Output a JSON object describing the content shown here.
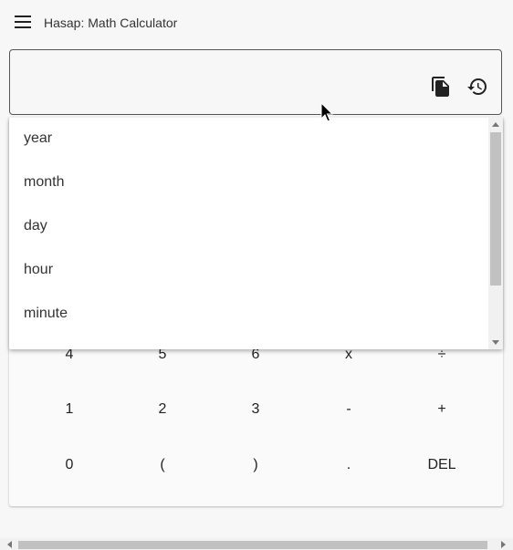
{
  "app": {
    "title": "Hasap: Math Calculator"
  },
  "expression": {
    "value": "",
    "placeholder": ""
  },
  "dropdown": {
    "items": [
      "year",
      "month",
      "day",
      "hour",
      "minute"
    ]
  },
  "keypad": {
    "rows": [
      [
        "4",
        "5",
        "6",
        "x",
        "÷"
      ],
      [
        "1",
        "2",
        "3",
        "-",
        "+"
      ],
      [
        "0",
        "(",
        ")",
        ".",
        "DEL"
      ]
    ]
  },
  "icons": {
    "menu": "menu-icon",
    "paste": "content-paste-icon",
    "history": "history-icon"
  }
}
